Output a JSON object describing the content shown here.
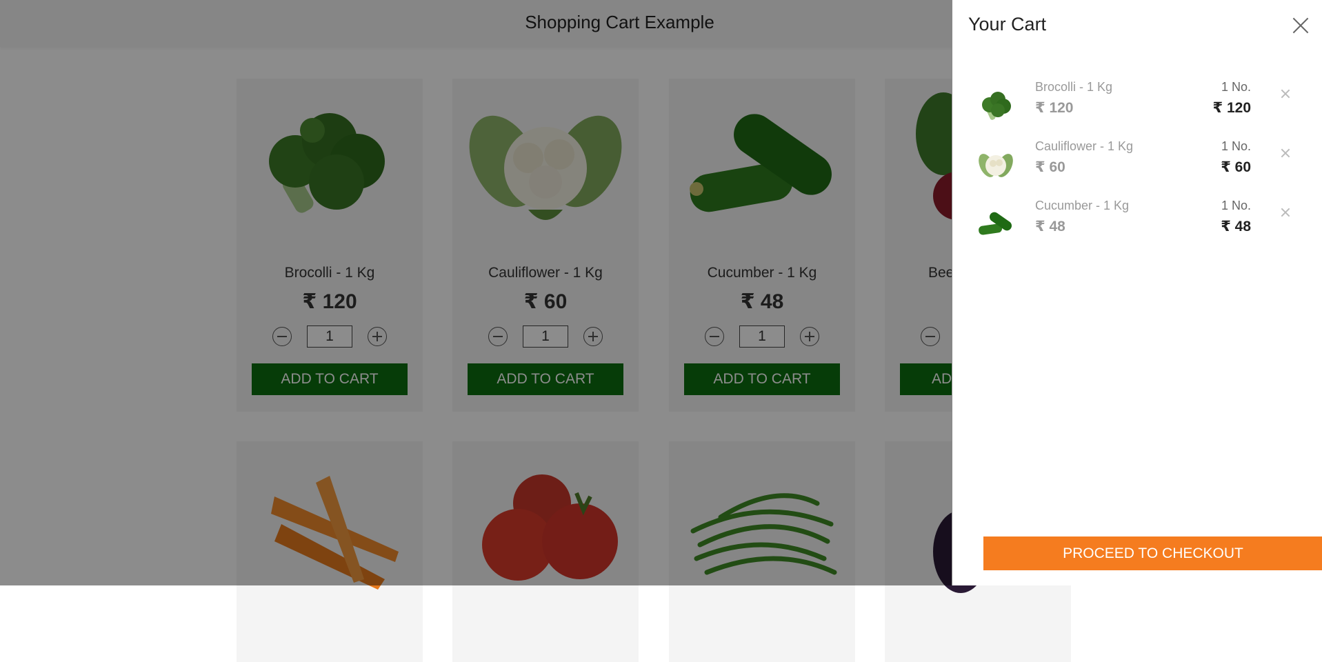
{
  "page": {
    "title": "Shopping Cart Example"
  },
  "products": [
    {
      "name": "Brocolli - 1 Kg",
      "price": "₹ 120",
      "quantity": "1",
      "add_label": "ADD TO CART",
      "icon": "broccoli-image"
    },
    {
      "name": "Cauliflower - 1 Kg",
      "price": "₹ 60",
      "quantity": "1",
      "add_label": "ADD TO CART",
      "icon": "cauliflower-image"
    },
    {
      "name": "Cucumber - 1 Kg",
      "price": "₹ 48",
      "quantity": "1",
      "add_label": "ADD TO CART",
      "icon": "cucumber-image"
    },
    {
      "name": "Bee",
      "price": "",
      "quantity": "",
      "add_label": "AD",
      "icon": "beetroot-image"
    },
    {
      "name": "",
      "price": "",
      "quantity": "",
      "add_label": "",
      "icon": "carrot-image"
    },
    {
      "name": "",
      "price": "",
      "quantity": "",
      "add_label": "",
      "icon": "tomato-image"
    },
    {
      "name": "",
      "price": "",
      "quantity": "",
      "add_label": "",
      "icon": "beans-image"
    },
    {
      "name": "",
      "price": "",
      "quantity": "",
      "add_label": "",
      "icon": "eggplant-image"
    }
  ],
  "cart": {
    "title": "Your Cart",
    "items": [
      {
        "name": "Brocolli - 1 Kg",
        "price": "₹ 120",
        "qty": "1 No.",
        "amount": "₹ 120",
        "icon": "broccoli-thumb"
      },
      {
        "name": "Cauliflower - 1 Kg",
        "price": "₹ 60",
        "qty": "1 No.",
        "amount": "₹ 60",
        "icon": "cauliflower-thumb"
      },
      {
        "name": "Cucumber - 1 Kg",
        "price": "₹ 48",
        "qty": "1 No.",
        "amount": "₹ 48",
        "icon": "cucumber-thumb"
      }
    ],
    "checkout_label": "PROCEED TO CHECKOUT"
  },
  "colors": {
    "add_button": "#0b6e0f",
    "checkout_button": "#f57c1f",
    "overlay": "rgba(0,0,0,0.45)"
  }
}
